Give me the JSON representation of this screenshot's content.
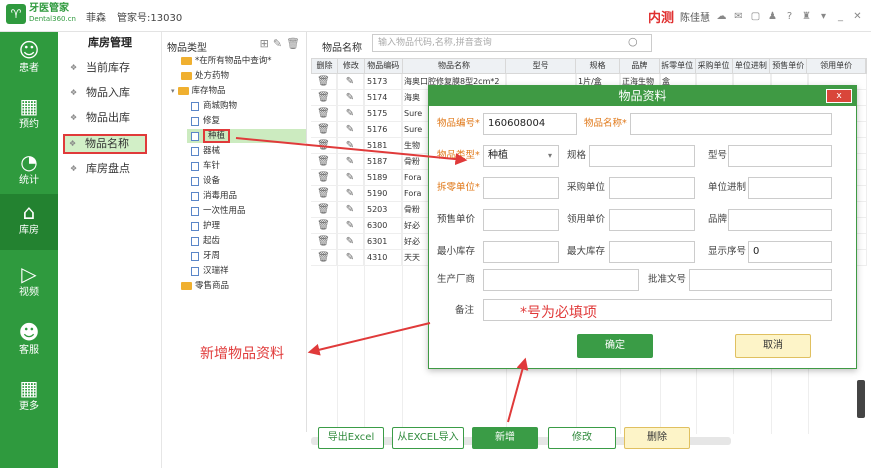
{
  "app": {
    "logo_text": "牙医管家",
    "logo_sub": "Dental360.cn",
    "user": "菲森",
    "account": "管家号:13030",
    "env": "内测",
    "username": "陈佳慧"
  },
  "nav": [
    {
      "label": "患者",
      "icon": "person-icon"
    },
    {
      "label": "预约",
      "icon": "calendar-icon"
    },
    {
      "label": "统计",
      "icon": "chart-icon"
    },
    {
      "label": "库房",
      "icon": "warehouse-icon"
    },
    {
      "label": "视频",
      "icon": "play-icon"
    },
    {
      "label": "客服",
      "icon": "chat-icon"
    },
    {
      "label": "更多",
      "icon": "grid-icon"
    }
  ],
  "sub": {
    "title": "库房管理",
    "items": [
      "当前库存",
      "物品入库",
      "物品出库",
      "物品名称",
      "库房盘点"
    ]
  },
  "tree": {
    "title": "物品类型",
    "nodes": [
      "*在所有物品中查询*",
      "处方药物",
      "库存物品",
      "商城购物",
      "修复",
      "种植",
      "器械",
      "车针",
      "设备",
      "消毒用品",
      "一次性用品",
      "护理",
      "起齿",
      "牙周",
      "汉瑞祥",
      "零售商品"
    ]
  },
  "grid": {
    "search_label": "物品名称",
    "search_placeholder": "输入物品代码,名称,拼音查询",
    "headers": [
      "删除",
      "修改",
      "物品编码",
      "物品名称",
      "型号",
      "规格",
      "品牌",
      "拆零单位",
      "采购单位",
      "单位进制",
      "预售单价",
      "领用单价"
    ],
    "codes": [
      "5173",
      "5174",
      "5175",
      "5176",
      "5181",
      "5187",
      "5189",
      "5190",
      "5203",
      "6300",
      "6301",
      "4310"
    ],
    "names": [
      "海奥口腔修复膜8型2cm*2",
      "海奥",
      "Sure",
      "Sure",
      "生物",
      "骨粉",
      "Fora",
      "Fora",
      "骨粉",
      "好必",
      "好必",
      "天天"
    ],
    "row0_spec": "1片/盒",
    "row0_brand": "正海生物",
    "row0_unit": "盒"
  },
  "buttons": {
    "export": "导出Excel",
    "import": "从EXCEL导入",
    "add": "新增",
    "edit": "修改",
    "delete": "删除"
  },
  "dialog": {
    "title": "物品资料",
    "close": "x",
    "code_label": "物品编号*",
    "code_value": "160608004",
    "name_label": "物品名称*",
    "type_label": "物品类型*",
    "type_value": "种植",
    "spec_label": "规格",
    "model_label": "型号",
    "unit_label": "拆零单位*",
    "purchase_unit_label": "采购单位",
    "unit_ratio_label": "单位进制",
    "sale_price_label": "预售单价",
    "use_price_label": "领用单价",
    "brand_label": "品牌",
    "min_stock_label": "最小库存",
    "max_stock_label": "最大库存",
    "order_label": "显示序号",
    "order_value": "0",
    "maker_label": "生产厂商",
    "approval_label": "批准文号",
    "remark_label": "备注",
    "confirm": "确定",
    "cancel": "取消"
  },
  "annotations": {
    "required_note": "*号为必填项",
    "add_note": "新增物品资料"
  }
}
